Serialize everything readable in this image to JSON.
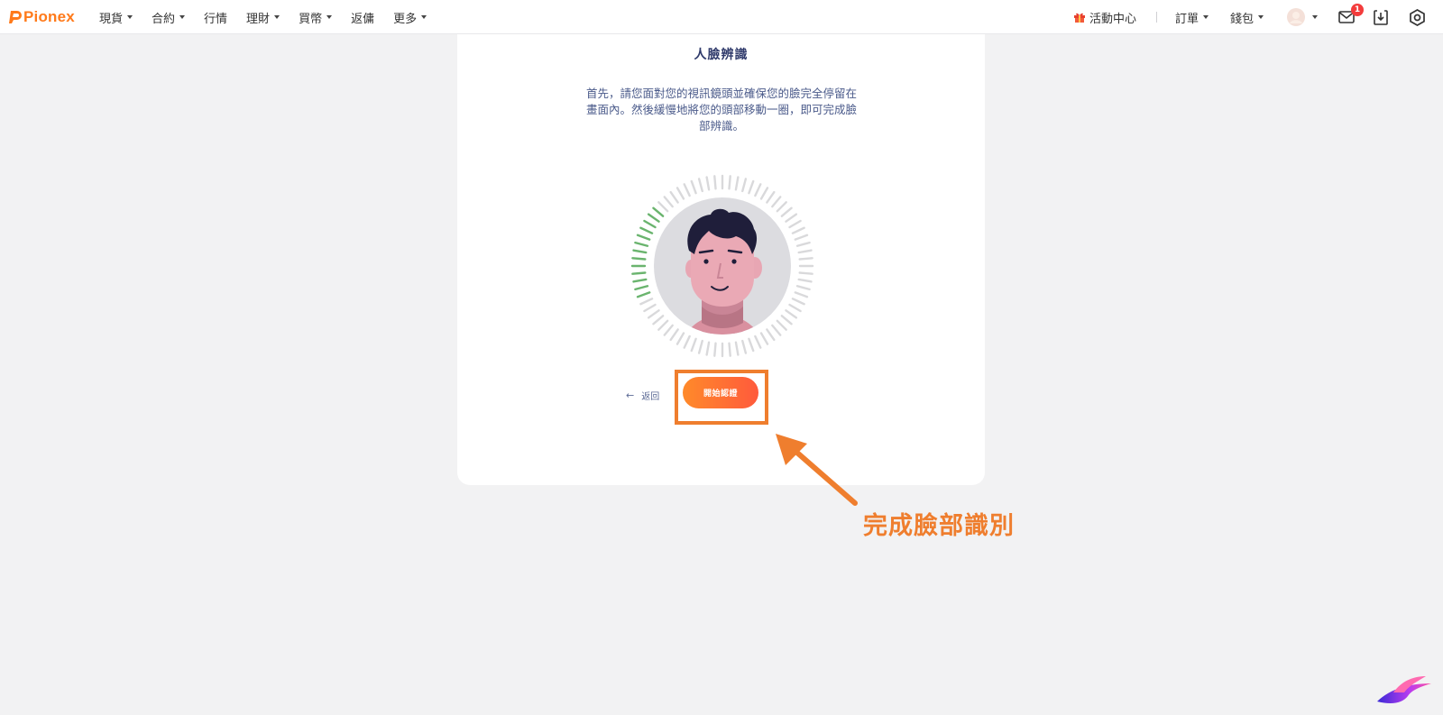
{
  "brand": {
    "name": "Pionex",
    "color": "#ff7a1a"
  },
  "nav": {
    "items": [
      {
        "label": "現貨",
        "dropdown": true
      },
      {
        "label": "合約",
        "dropdown": true
      },
      {
        "label": "行情",
        "dropdown": false
      },
      {
        "label": "理財",
        "dropdown": true
      },
      {
        "label": "買幣",
        "dropdown": true
      },
      {
        "label": "返傭",
        "dropdown": false
      },
      {
        "label": "更多",
        "dropdown": true
      }
    ]
  },
  "right_nav": {
    "events_label": "活動中心",
    "orders_label": "訂單",
    "wallet_label": "錢包",
    "mail_badge": "1",
    "icons": [
      "gift-icon",
      "avatar",
      "mail-icon",
      "download-icon",
      "settings-icon"
    ]
  },
  "card": {
    "title": "人臉辨識",
    "description": "首先，請您面對您的視訊鏡頭並確保您的臉完全停留在畫面內。然後緩慢地將您的頭部移動一圈，即可完成臉部辨識。",
    "back_label": "返回",
    "start_label": "開始認證",
    "progress_fraction": 0.17
  },
  "annotation": {
    "text": "完成臉部識別",
    "color": "#ef7e2e"
  },
  "colors": {
    "accent": "#ff7a1a",
    "progress_green": "#6ab46e",
    "tick_gray": "#d9d9db",
    "title_navy": "#2f3a6b"
  }
}
